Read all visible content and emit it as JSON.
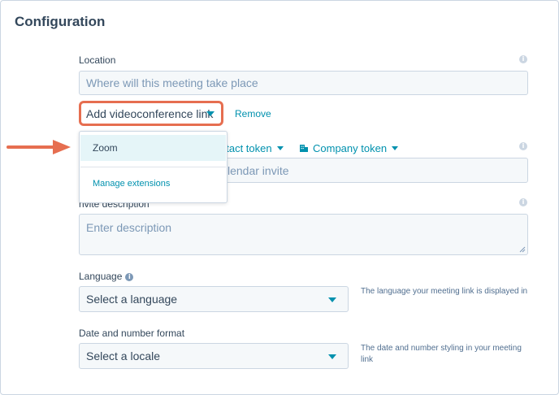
{
  "section": {
    "title": "Configuration"
  },
  "location": {
    "label": "Location",
    "placeholder": "Where will this meeting take place",
    "add_videoconference_label": "Add videoconference link",
    "remove_label": "Remove"
  },
  "dropdown": {
    "items": [
      {
        "label": "Zoom"
      },
      {
        "label": "Manage extensions"
      }
    ]
  },
  "title_field": {
    "contact_token_label": "ntact token",
    "company_token_label": "Company token",
    "placeholder_visible": "lendar invite"
  },
  "invite_description": {
    "label": "nvite description",
    "placeholder": "Enter description"
  },
  "language": {
    "label": "Language",
    "selected": "Select a language",
    "help": "The language your meeting link is displayed in"
  },
  "date_format": {
    "label": "Date and number format",
    "selected": "Select a locale",
    "help_line1": "The date and number styling in your meeting",
    "help_line2": "link"
  },
  "colors": {
    "accent": "#0091ae",
    "highlight": "#e66e50",
    "text": "#33475b"
  }
}
